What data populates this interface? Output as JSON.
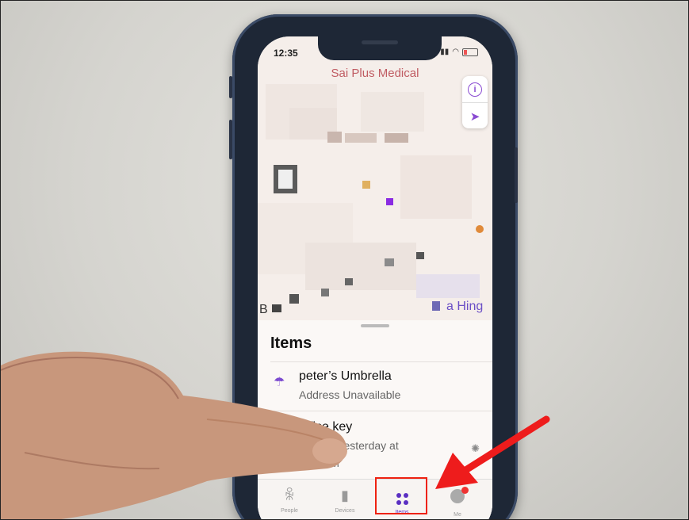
{
  "status_bar": {
    "time": "12:35"
  },
  "map": {
    "title": "Sai Plus Medical",
    "label_right": "a Hing",
    "label_left": "B",
    "controls": {
      "info_icon": "info-icon",
      "location_icon": "location-arrow-icon"
    }
  },
  "items_sheet": {
    "title": "Items",
    "items": [
      {
        "name": "peter’s Umbrella",
        "status": "Address Unavailable",
        "icon": "umbrella-icon"
      },
      {
        "name": "office key",
        "status": "en yesterday at",
        "status_line2": "AM",
        "icon": "key-icon"
      }
    ]
  },
  "tabbar": {
    "tabs": [
      {
        "label": "People",
        "icon": "people-icon"
      },
      {
        "label": "Devices",
        "icon": "devices-icon"
      },
      {
        "label": "Items",
        "icon": "items-icon",
        "active": true
      },
      {
        "label": "Me",
        "icon": "me-icon"
      }
    ]
  },
  "colors": {
    "accent": "#5a2fc2",
    "map_title": "#c05c63",
    "highlight": "#e21"
  }
}
